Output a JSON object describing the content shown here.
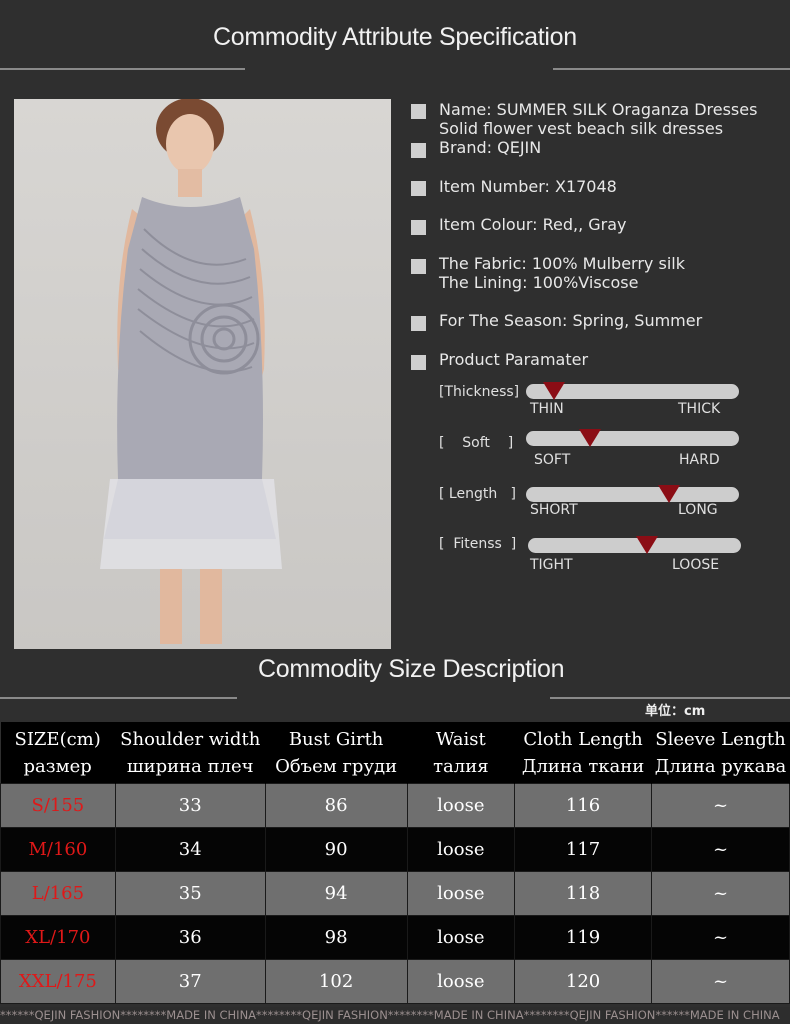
{
  "header": {
    "title": "Commodity Attribute Specification"
  },
  "attributes": [
    {
      "lines": [
        "Name: SUMMER SILK Oraganza Dresses",
        "Solid flower vest beach silk dresses"
      ]
    },
    {
      "lines": [
        "Brand: QEJIN"
      ]
    },
    {
      "lines": [
        "Item Number:  X17048"
      ]
    },
    {
      "lines": [
        "Item Colour:   Red,, Gray"
      ]
    },
    {
      "lines": [
        "The Fabric:  100% Mulberry silk",
        "The Lining: 100%Viscose"
      ]
    },
    {
      "lines": [
        "For The Season:  Spring, Summer"
      ]
    },
    {
      "lines": [
        "Product Paramater"
      ]
    }
  ],
  "params": [
    {
      "label": "[Thickness]",
      "low": "THIN",
      "high": "THICK",
      "level": 0.13
    },
    {
      "label": "[    Soft    ]",
      "low": "SOFT",
      "high": "HARD",
      "level": 0.3
    },
    {
      "label": "[ Length   ]",
      "low": "SHORT",
      "high": "LONG",
      "level": 0.67
    },
    {
      "label": "[  Fitenss  ]",
      "low": "TIGHT",
      "high": "LOOSE",
      "level": 0.56
    }
  ],
  "size_section": {
    "title": "Commodity Size Description",
    "unit": "单位：cm"
  },
  "size_table": {
    "headers": [
      [
        "SIZE(cm)",
        "размер"
      ],
      [
        "Shoulder width",
        "ширина плеч"
      ],
      [
        "Bust Girth",
        "Объем груди"
      ],
      [
        "Waist",
        "талия"
      ],
      [
        "Cloth Length",
        "Длина ткани"
      ],
      [
        "Sleeve Length",
        "Длина рукава"
      ]
    ],
    "rows": [
      [
        "S/155",
        "33",
        "86",
        "loose",
        "116",
        "~"
      ],
      [
        "M/160",
        "34",
        "90",
        "loose",
        "117",
        "~"
      ],
      [
        "L/165",
        "35",
        "94",
        "loose",
        "118",
        "~"
      ],
      [
        "XL/170",
        "36",
        "98",
        "loose",
        "119",
        "~"
      ],
      [
        "XXL/175",
        "37",
        "102",
        "loose",
        "120",
        "~"
      ]
    ]
  },
  "footer": {
    "text": "******QEJIN FASHION********MADE IN CHINA********QEJIN FASHION********MADE IN CHINA********QEJIN FASHION******MADE IN CHINA"
  },
  "colors": {
    "marker": "#8b0d15",
    "size_text": "#e01818",
    "background": "#2f2f2f"
  }
}
